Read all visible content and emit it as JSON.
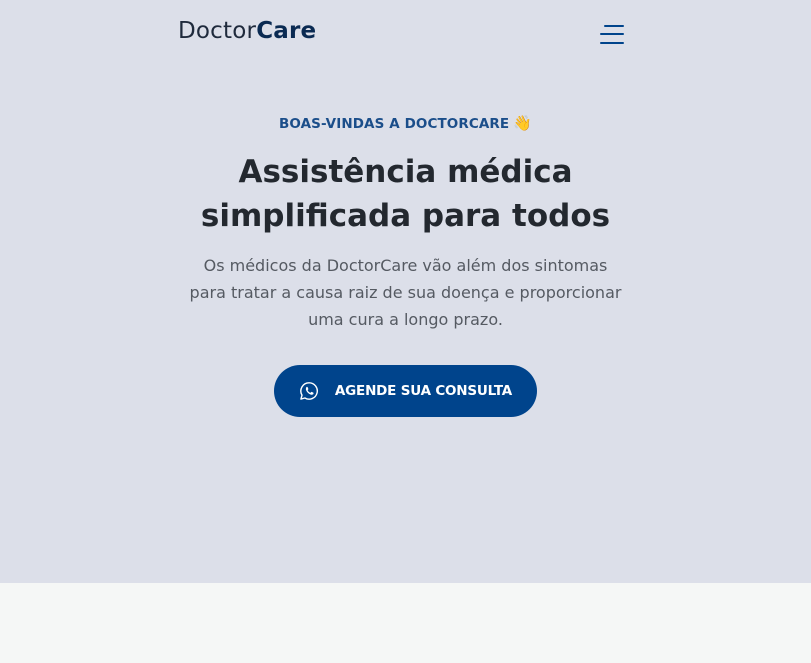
{
  "header": {
    "logo_light": "Doctor",
    "logo_bold": "Care",
    "menu_icon": "hamburger-menu-icon"
  },
  "hero": {
    "eyebrow": "BOAS-VINDAS A DOCTORCARE",
    "eyebrow_emoji": "👋",
    "title_line1": "Assistência médica",
    "title_line2": "simplificada para todos",
    "description_line1": "Os médicos da DoctorCare vão além dos sintomas",
    "description_line2": "para tratar a causa raiz de sua doença e proporcionar",
    "description_line3": "uma cura a longo prazo.",
    "cta_label": "AGENDE SUA CONSULTA",
    "cta_icon": "whatsapp-icon"
  },
  "colors": {
    "hero_bg": "#dcdfe9",
    "primary": "#00448c",
    "lower_bg": "#f5f7f6",
    "heading": "#23282f"
  }
}
